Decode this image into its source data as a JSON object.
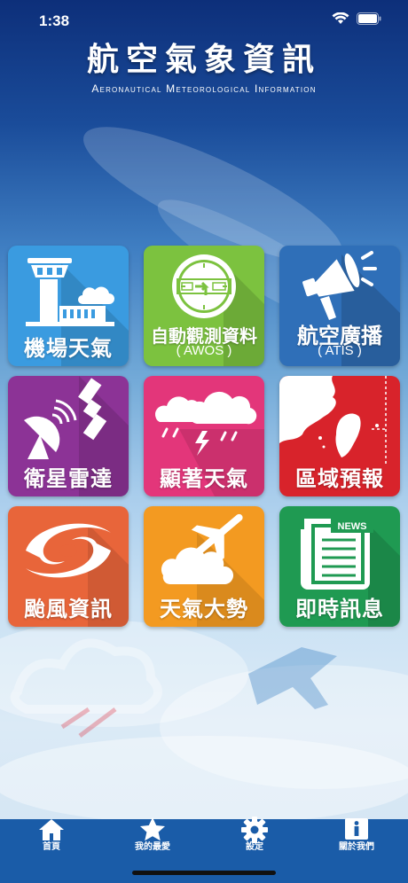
{
  "status_bar": {
    "time": "1:38"
  },
  "header": {
    "title": "航空氣象資訊",
    "subtitle": "Aeronautical Meteorological Information"
  },
  "tiles": [
    {
      "label": "機場天氣",
      "color": "#3a9be0",
      "icon": "control-tower-icon"
    },
    {
      "label": "自動觀測資料",
      "sub": "( AWOS )",
      "color": "#7cc23f",
      "icon": "gauge-icon"
    },
    {
      "label": "航空廣播",
      "sub": "( ATIS )",
      "color": "#2f6fb8",
      "icon": "megaphone-icon"
    },
    {
      "label": "衛星雷達",
      "color": "#8c3396",
      "icon": "satellite-icon"
    },
    {
      "label": "顯著天氣",
      "color": "#e3367a",
      "icon": "storm-cloud-icon"
    },
    {
      "label": "區域預報",
      "color": "#d8232b",
      "icon": "taiwan-map-icon"
    },
    {
      "label": "颱風資訊",
      "color": "#e8653a",
      "icon": "typhoon-icon"
    },
    {
      "label": "天氣大勢",
      "color": "#f39a21",
      "icon": "plane-cloud-icon"
    },
    {
      "label": "即時訊息",
      "color": "#1f9a52",
      "icon": "newspaper-icon",
      "news": "NEWS"
    }
  ],
  "tabbar": {
    "items": [
      {
        "label": "首頁",
        "icon": "home-icon"
      },
      {
        "label": "我的最愛",
        "icon": "star-icon"
      },
      {
        "label": "設定",
        "icon": "gear-icon"
      },
      {
        "label": "關於我們",
        "icon": "info-icon"
      }
    ]
  }
}
